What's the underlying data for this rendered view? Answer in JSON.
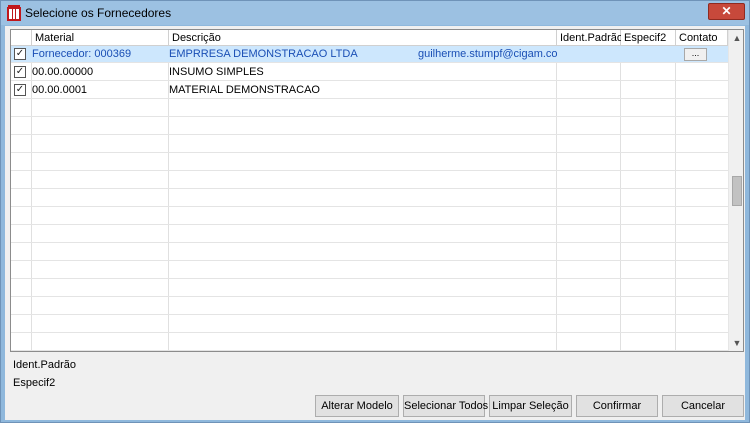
{
  "window": {
    "title": "Selecione os Fornecedores",
    "close_glyph": "✕"
  },
  "grid": {
    "columns": [
      "Material",
      "Descrição",
      "Ident.Padrão",
      "Especif2",
      "Contato"
    ],
    "rows": [
      {
        "checked": true,
        "material": "Fornecedor:  000369",
        "descricao": "EMPRRESA DEMONSTRACAO LTDA",
        "email": "guilherme.stumpf@cigam.com.br",
        "contato_button": "...",
        "selected": true
      },
      {
        "checked": true,
        "material": "00.00.00000",
        "descricao": "INSUMO SIMPLES",
        "email": "",
        "contato_button": "",
        "selected": false
      },
      {
        "checked": true,
        "material": "00.00.0001",
        "descricao": "MATERIAL DEMONSTRACAO",
        "email": "",
        "contato_button": "",
        "selected": false
      }
    ],
    "check_glyph": "✓",
    "scroll_up_glyph": "▲",
    "scroll_down_glyph": "▼"
  },
  "labels": {
    "ident_padrao": "Ident.Padrão",
    "especif2": "Especif2"
  },
  "buttons": {
    "alterar_modelo": "Alterar Modelo",
    "selecionar_todos": "Selecionar Todos",
    "limpar_selecao": "Limpar Seleção",
    "confirmar": "Confirmar",
    "cancelar": "Cancelar"
  },
  "colors": {
    "title_bar": "#9cc1e2",
    "selected_row": "#cde7fd",
    "selected_text": "#1a4fb5",
    "close_button": "#c7493b"
  }
}
